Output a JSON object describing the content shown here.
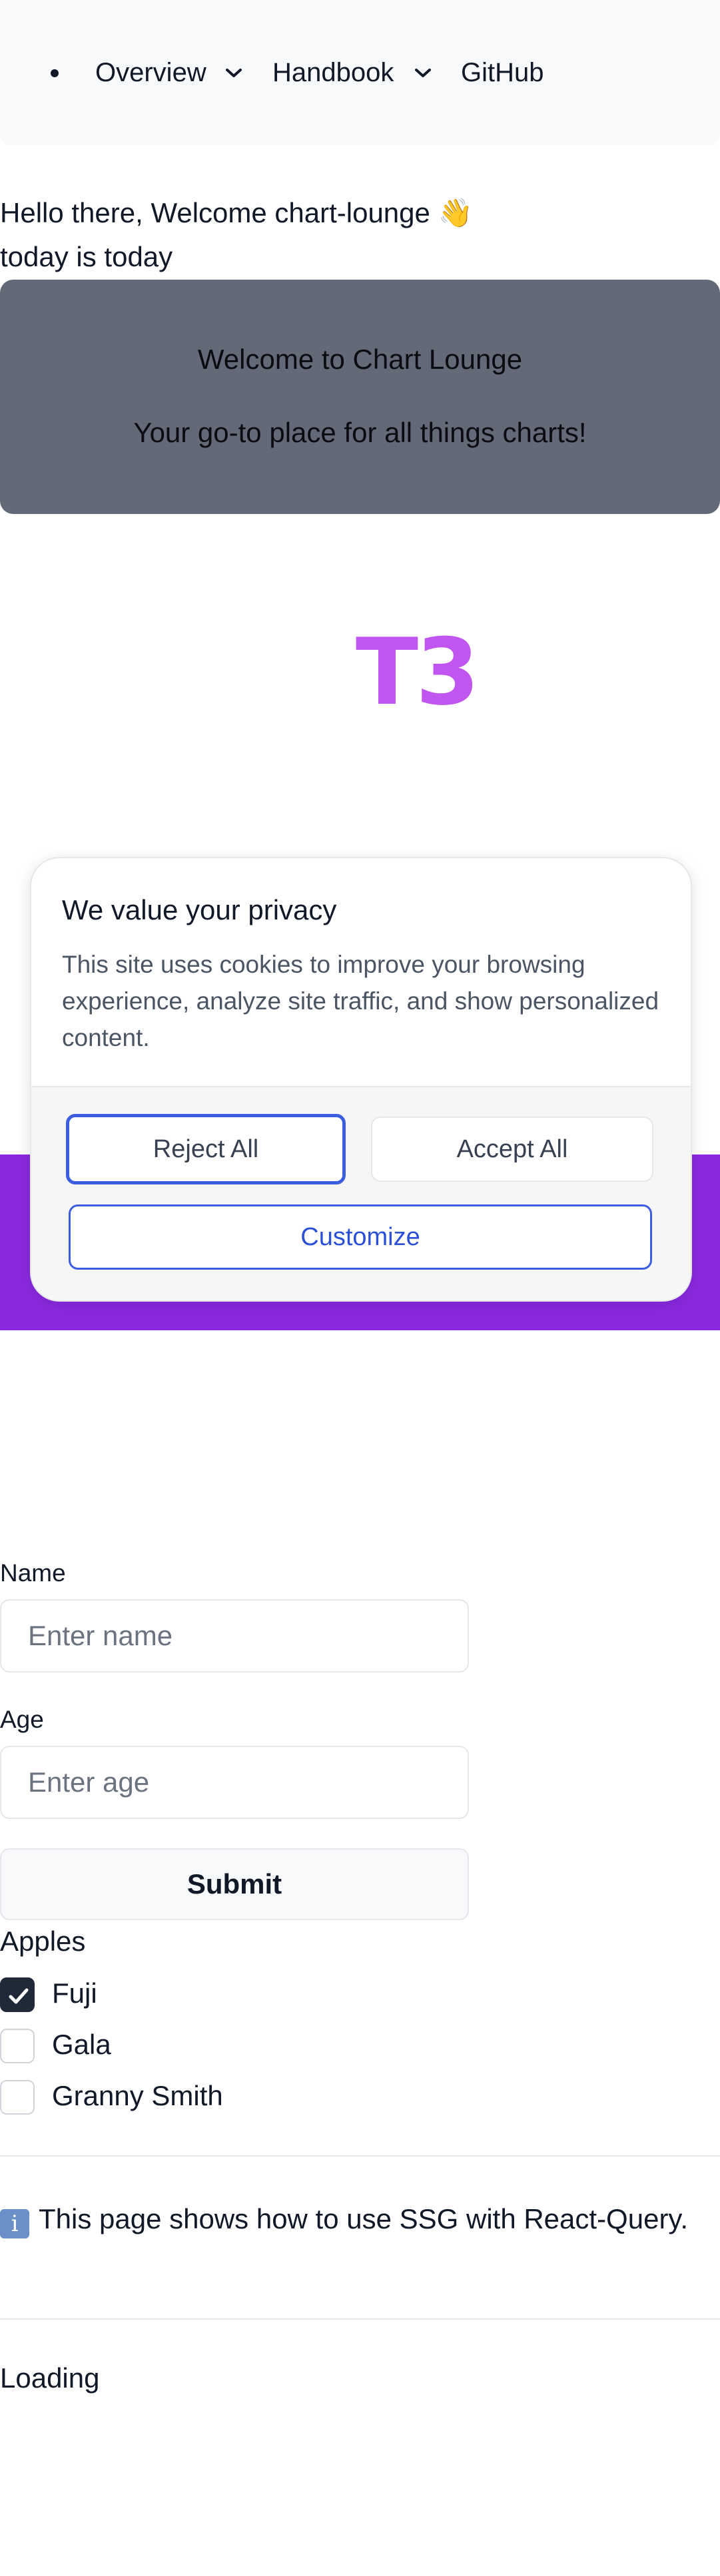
{
  "nav": {
    "items": [
      {
        "label": "Overview",
        "has_dropdown": true
      },
      {
        "label": "Handbook",
        "has_dropdown": true
      },
      {
        "label": "GitHub",
        "has_dropdown": false
      }
    ]
  },
  "greeting": {
    "line1": "Hello there, Welcome chart-lounge 👋",
    "line2": "today is today"
  },
  "hero": {
    "title": "Welcome to Chart Lounge",
    "subtitle": "Your go-to place for all things charts!",
    "background_color": "#636977"
  },
  "logo": {
    "text": "T3",
    "color": "#c155f0"
  },
  "band": {
    "color": "#8b29e0"
  },
  "cookie_banner": {
    "title": "We value your privacy",
    "body": "This site uses cookies to improve your browsing experience, analyze site traffic, and show personalized content.",
    "reject_label": "Reject All",
    "accept_label": "Accept All",
    "customize_label": "Customize",
    "accent_color": "#3b5ee0"
  },
  "form": {
    "name_label": "Name",
    "name_placeholder": "Enter name",
    "name_value": "",
    "age_label": "Age",
    "age_placeholder": "Enter age",
    "age_value": "",
    "submit_label": "Submit"
  },
  "apples": {
    "legend": "Apples",
    "options": [
      {
        "label": "Fuji",
        "checked": true
      },
      {
        "label": "Gala",
        "checked": false
      },
      {
        "label": "Granny Smith",
        "checked": false
      }
    ]
  },
  "info": {
    "icon": "info-icon",
    "icon_glyph": "i",
    "text": "This page shows how to use SSG with React-Query."
  },
  "status": {
    "text": "Loading"
  }
}
